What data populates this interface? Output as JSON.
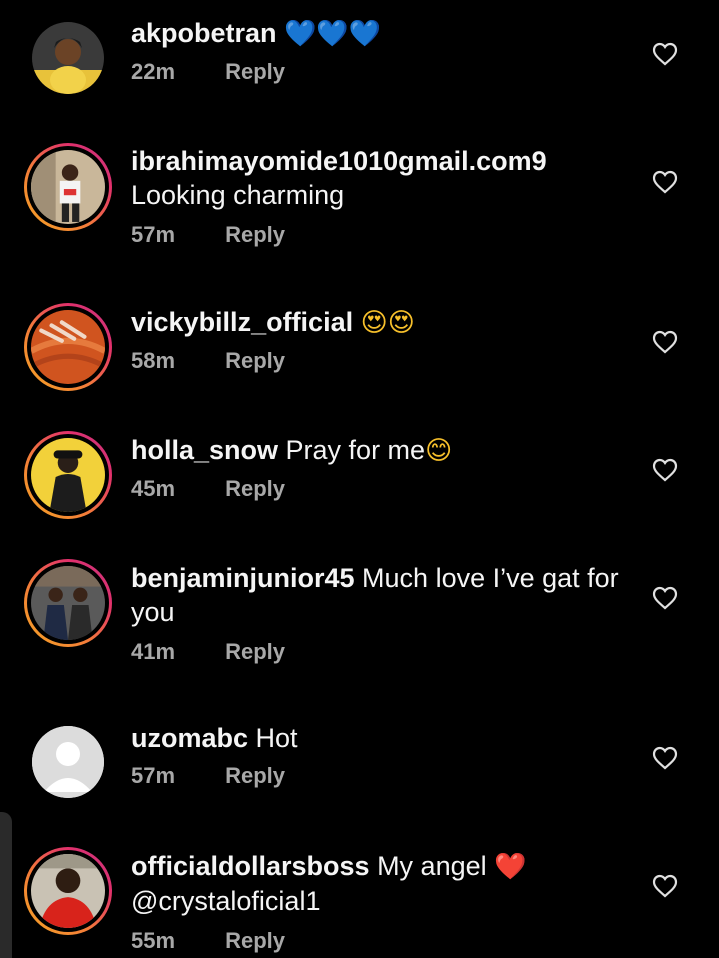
{
  "comments": [
    {
      "username": "akpobetran",
      "text": "",
      "emoji": "💙💙💙",
      "time": "22m",
      "reply": "Reply",
      "ring": false,
      "avatar": "akpobetran-avatar"
    },
    {
      "username": "ibrahimayomide1010gmail.com9",
      "text": "Looking charming",
      "emoji": "",
      "time": "57m",
      "reply": "Reply",
      "ring": true,
      "avatar": "ibrahim-avatar"
    },
    {
      "username": "vickybillz_official",
      "text": "",
      "emoji": "😍😍",
      "time": "58m",
      "reply": "Reply",
      "ring": true,
      "avatar": "vicky-avatar"
    },
    {
      "username": "holla_snow",
      "text": " Pray for me",
      "emoji": "😊",
      "time": "45m",
      "reply": "Reply",
      "ring": true,
      "avatar": "holla-avatar"
    },
    {
      "username": "benjaminjunior45",
      "text": " Much love I’ve gat for",
      "text2": "you",
      "emoji": "",
      "time": "41m",
      "reply": "Reply",
      "ring": true,
      "avatar": "benjamin-avatar"
    },
    {
      "username": "uzomabc",
      "text": " Hot",
      "emoji": "",
      "time": "57m",
      "reply": "Reply",
      "ring": false,
      "avatar": "uzoma-avatar"
    },
    {
      "username": "officialdollarsboss",
      "text": " My angel ",
      "emoji": "❤️",
      "text2": "@crystaloficial1",
      "time": "55m",
      "reply": "Reply",
      "ring": true,
      "avatar": "dollarsboss-avatar"
    }
  ],
  "colors": {
    "background": "#000000",
    "primary_text": "#f5f5f5",
    "secondary_text": "#a8a8a8",
    "story_ring_start": "#f5a623",
    "story_ring_end": "#c13584"
  },
  "icons": {
    "like": "heart-outline-icon"
  }
}
